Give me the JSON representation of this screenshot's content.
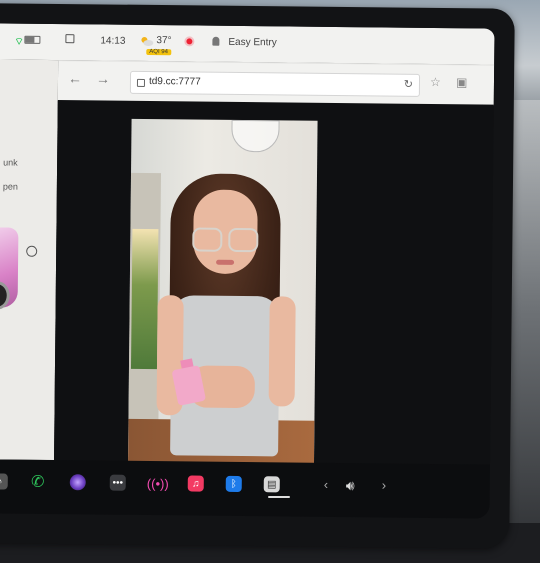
{
  "status_bar": {
    "time": "14:13",
    "temperature": "37°",
    "aqi": "AQI 94",
    "profile": "Easy Entry"
  },
  "browser": {
    "url": "td9.cc:7777"
  },
  "car_panel": {
    "label_1": "unk",
    "label_2": "pen"
  },
  "icons": [
    "back-arrow-icon",
    "forward-arrow-icon",
    "lock-icon",
    "reload-icon",
    "star-icon",
    "tab-icon",
    "phone-icon",
    "camera-icon",
    "dots-icon",
    "radio-icon",
    "music-icon",
    "bluetooth-icon",
    "calendar-icon",
    "volume-icon"
  ]
}
